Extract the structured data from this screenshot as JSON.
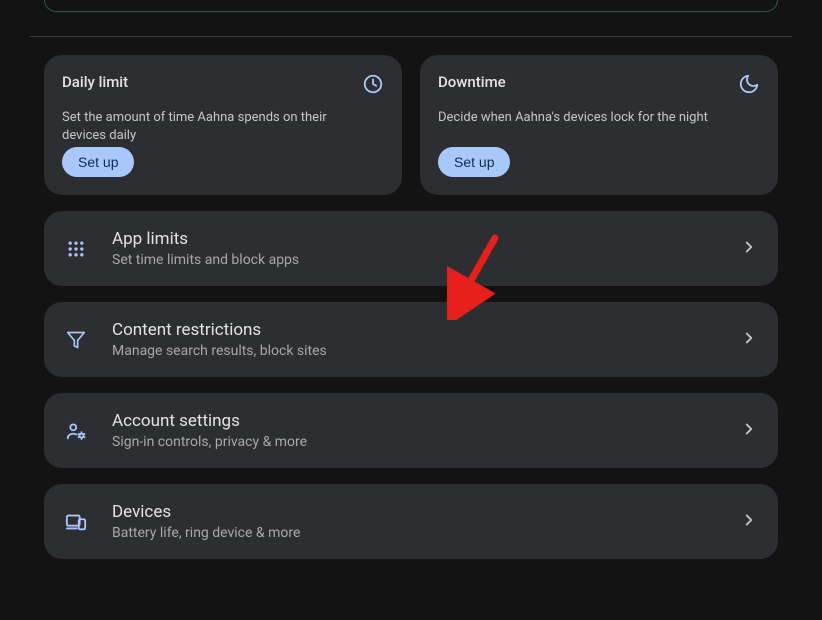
{
  "cards": {
    "daily_limit": {
      "title": "Daily limit",
      "desc": "Set the amount of time Aahna spends on their devices daily",
      "button": "Set up"
    },
    "downtime": {
      "title": "Downtime",
      "desc": "Decide when Aahna's devices lock for the night",
      "button": "Set up"
    }
  },
  "list": {
    "app_limits": {
      "title": "App limits",
      "sub": "Set time limits and block apps"
    },
    "content_restrictions": {
      "title": "Content restrictions",
      "sub": "Manage search results, block sites"
    },
    "account_settings": {
      "title": "Account settings",
      "sub": "Sign-in controls, privacy & more"
    },
    "devices": {
      "title": "Devices",
      "sub": "Battery life, ring device & more"
    }
  }
}
